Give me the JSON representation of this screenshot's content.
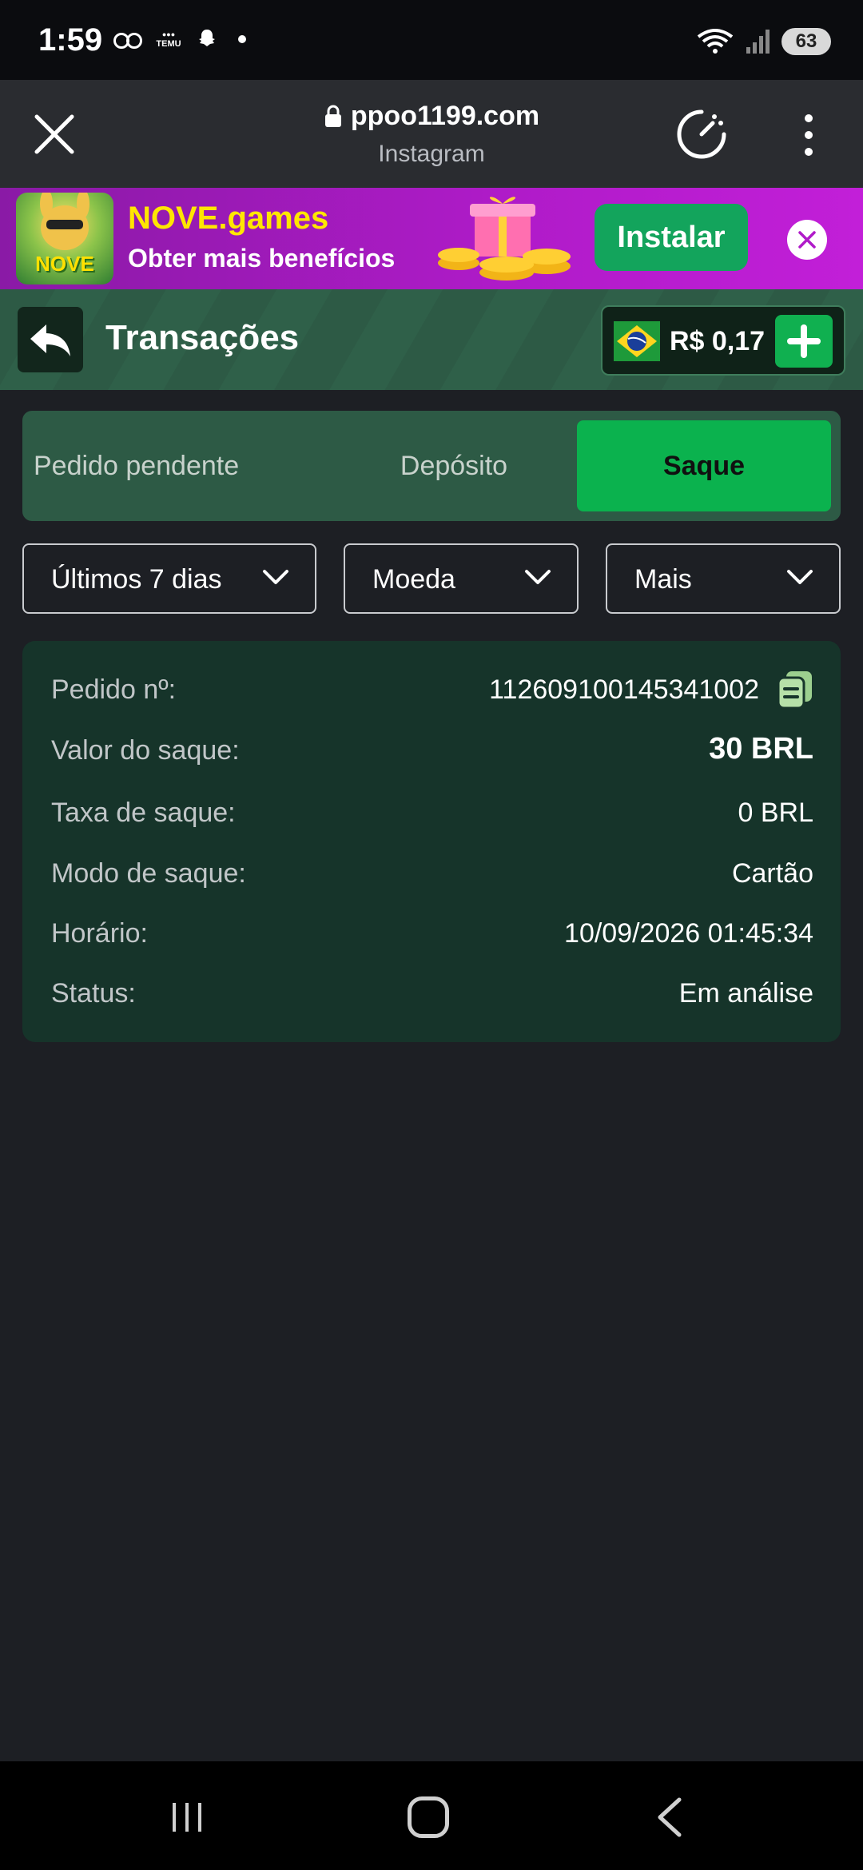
{
  "status_bar": {
    "time": "1:59",
    "temu_label": "TEMU",
    "battery": "63"
  },
  "browser": {
    "url": "ppoo1199.com",
    "source": "Instagram"
  },
  "promo": {
    "app_name": "NOVE.games",
    "logo_text": "NOVE",
    "subtitle": "Obter mais benefícios",
    "install_label": "Instalar"
  },
  "header": {
    "title": "Transações",
    "balance": "R$ 0,17"
  },
  "tabs": [
    {
      "label": "Pedido pendente",
      "active": false
    },
    {
      "label": "Depósito",
      "active": false
    },
    {
      "label": "Saque",
      "active": true
    }
  ],
  "filters": {
    "period": "Últimos 7 dias",
    "currency": "Moeda",
    "more": "Mais"
  },
  "transaction": {
    "order_label": "Pedido nº:",
    "order_value": "112609100145341002",
    "amount_label": "Valor do saque:",
    "amount_value": "30 BRL",
    "fee_label": "Taxa de saque:",
    "fee_value": "0 BRL",
    "mode_label": "Modo de saque:",
    "mode_value": "Cartão",
    "time_label": "Horário:",
    "time_value": "10/09/2026 01:45:34",
    "status_label": "Status:",
    "status_value": "Em análise"
  },
  "colors": {
    "background": "#1d1f24",
    "accent_green": "#0bb24e",
    "card_green": "#16342a",
    "promo_purple": "#b01bc9",
    "promo_yellow": "#ffe600"
  },
  "icons": [
    "voicemail-icon",
    "temu-icon",
    "snapchat-icon",
    "wifi-icon",
    "signal-icon",
    "close-icon",
    "lock-icon",
    "speedometer-icon",
    "more-vert-icon",
    "gift-icon",
    "back-arrow-icon",
    "brazil-flag-icon",
    "plus-icon",
    "chevron-down-icon",
    "copy-icon",
    "recent-apps-icon",
    "home-icon",
    "nav-back-icon"
  ]
}
